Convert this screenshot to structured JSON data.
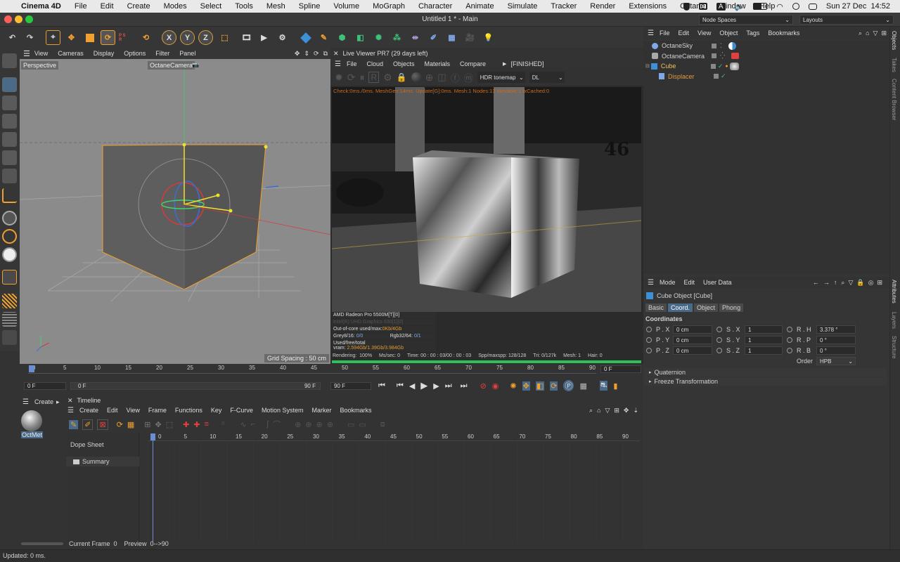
{
  "mac": {
    "app": "Cinema 4D",
    "menus": [
      "File",
      "Edit",
      "Create",
      "Modes",
      "Select",
      "Tools",
      "Mesh",
      "Spline",
      "Volume",
      "MoGraph",
      "Character",
      "Animate",
      "Simulate",
      "Tracker",
      "Render",
      "Extensions",
      "Octane",
      "Window",
      "Help"
    ],
    "input_letter": "A",
    "datetime": "Sun 27 Dec  14:52"
  },
  "window": {
    "title": "Untitled 1 * - Main",
    "node_spaces": "Node Spaces",
    "layouts": "Layouts"
  },
  "toolbar": {
    "xyz": [
      "X",
      "Y",
      "Z"
    ],
    "psr_letters": "P S R"
  },
  "viewport": {
    "menus": [
      "View",
      "Cameras",
      "Display",
      "Options",
      "Filter",
      "Panel"
    ],
    "name": "Perspective",
    "camera": "OctaneCamera",
    "grid_spacing": "Grid Spacing : 50 cm"
  },
  "liveviewer": {
    "title": "Live Viewer PR7 (29 days left)",
    "menus": [
      "File",
      "Cloud",
      "Objects",
      "Materials",
      "Compare"
    ],
    "status": "[FINISHED]",
    "tonemap": "HDR tonemap",
    "kernel": "DL",
    "check": "Check:0ms./0ms. MeshGen:14ms. Update[G]:0ms. Mesh:1 Nodes:13 Movable:1 txCached:0",
    "gpu1": "AMD Radeon Pro 5500M[T][0]",
    "gpu2": "Intel(R) UHD Graphics 630[1][0]",
    "ooc_label": "Out-of-core used/max:",
    "ooc_value": "0Kb/4Gb",
    "grey_label": "Grey8/16:",
    "grey_value": "0/0",
    "rgb_label": "Rgb32/64:",
    "rgb_value": "0/1",
    "vram_label": "Used/free/total vram:",
    "vram_value": "2.594Gb/1.39Gb/3.984Gb",
    "rendering": "Rendering:  100%",
    "mssec": "Ms/sec: 0",
    "time": "Time: 00 : 00 : 03/00 : 00 : 03",
    "spp": "Spp/maxspp: 128/128",
    "tri": "Tri: 0/127k",
    "mesh": "Mesh: 1",
    "hair": "Hair: 0",
    "progress": 1.0,
    "wall_number": "46"
  },
  "timeline": {
    "ruler": [
      "0",
      "5",
      "10",
      "15",
      "20",
      "25",
      "30",
      "35",
      "40",
      "45",
      "50",
      "55",
      "60",
      "65",
      "70",
      "75",
      "80",
      "85",
      "90"
    ],
    "current_frame_right": "0 F",
    "start": "0 F",
    "start2": "0 F",
    "end": "90 F",
    "end2": "90 F"
  },
  "objects": {
    "menus": [
      "File",
      "Edit",
      "View",
      "Object",
      "Tags",
      "Bookmarks"
    ],
    "items": [
      {
        "name": "OctaneSky",
        "color": "#d6d6d6"
      },
      {
        "name": "OctaneCamera",
        "color": "#d6d6d6"
      },
      {
        "name": "Cube",
        "color": "#f2c05a"
      },
      {
        "name": "Displacer",
        "color": "#e09a3e"
      }
    ]
  },
  "attributes": {
    "menus": [
      "Mode",
      "Edit",
      "User Data"
    ],
    "object_title": "Cube Object [Cube]",
    "tabs": [
      "Basic",
      "Coord.",
      "Object",
      "Phong"
    ],
    "active_tab": "Coord.",
    "section": "Coordinates",
    "rows": [
      {
        "p_label": "P . X",
        "p_val": "0 cm",
        "s_label": "S . X",
        "s_val": "1",
        "r_label": "R . H",
        "r_val": "3.378 °"
      },
      {
        "p_label": "P . Y",
        "p_val": "0 cm",
        "s_label": "S . Y",
        "s_val": "1",
        "r_label": "R . P",
        "r_val": "0 °"
      },
      {
        "p_label": "P . Z",
        "p_val": "0 cm",
        "s_label": "S . Z",
        "s_val": "1",
        "r_label": "R . B",
        "r_val": "0 °"
      }
    ],
    "order_label": "Order",
    "order_value": "HPB",
    "quaternion": "Quaternion",
    "freeze": "Freeze Transformation"
  },
  "side_tabs": [
    "Objects",
    "Takes",
    "Content Browser",
    "Attributes",
    "Layers",
    "Structure"
  ],
  "material": {
    "create_label": "Create",
    "material_name": "OctMet"
  },
  "dope": {
    "tab": "Timeline",
    "menus": [
      "Create",
      "Edit",
      "View",
      "Frame",
      "Functions",
      "Key",
      "F-Curve",
      "Motion System",
      "Marker",
      "Bookmarks"
    ],
    "dope_sheet": "Dope Sheet",
    "summary": "Summary",
    "ruler": [
      "0",
      "5",
      "10",
      "15",
      "20",
      "25",
      "30",
      "35",
      "40",
      "45",
      "50",
      "55",
      "60",
      "65",
      "70",
      "75",
      "80",
      "85",
      "90"
    ],
    "current_frame": "Current Frame  0",
    "preview": "Preview  0-->90"
  },
  "status": "Updated: 0 ms."
}
